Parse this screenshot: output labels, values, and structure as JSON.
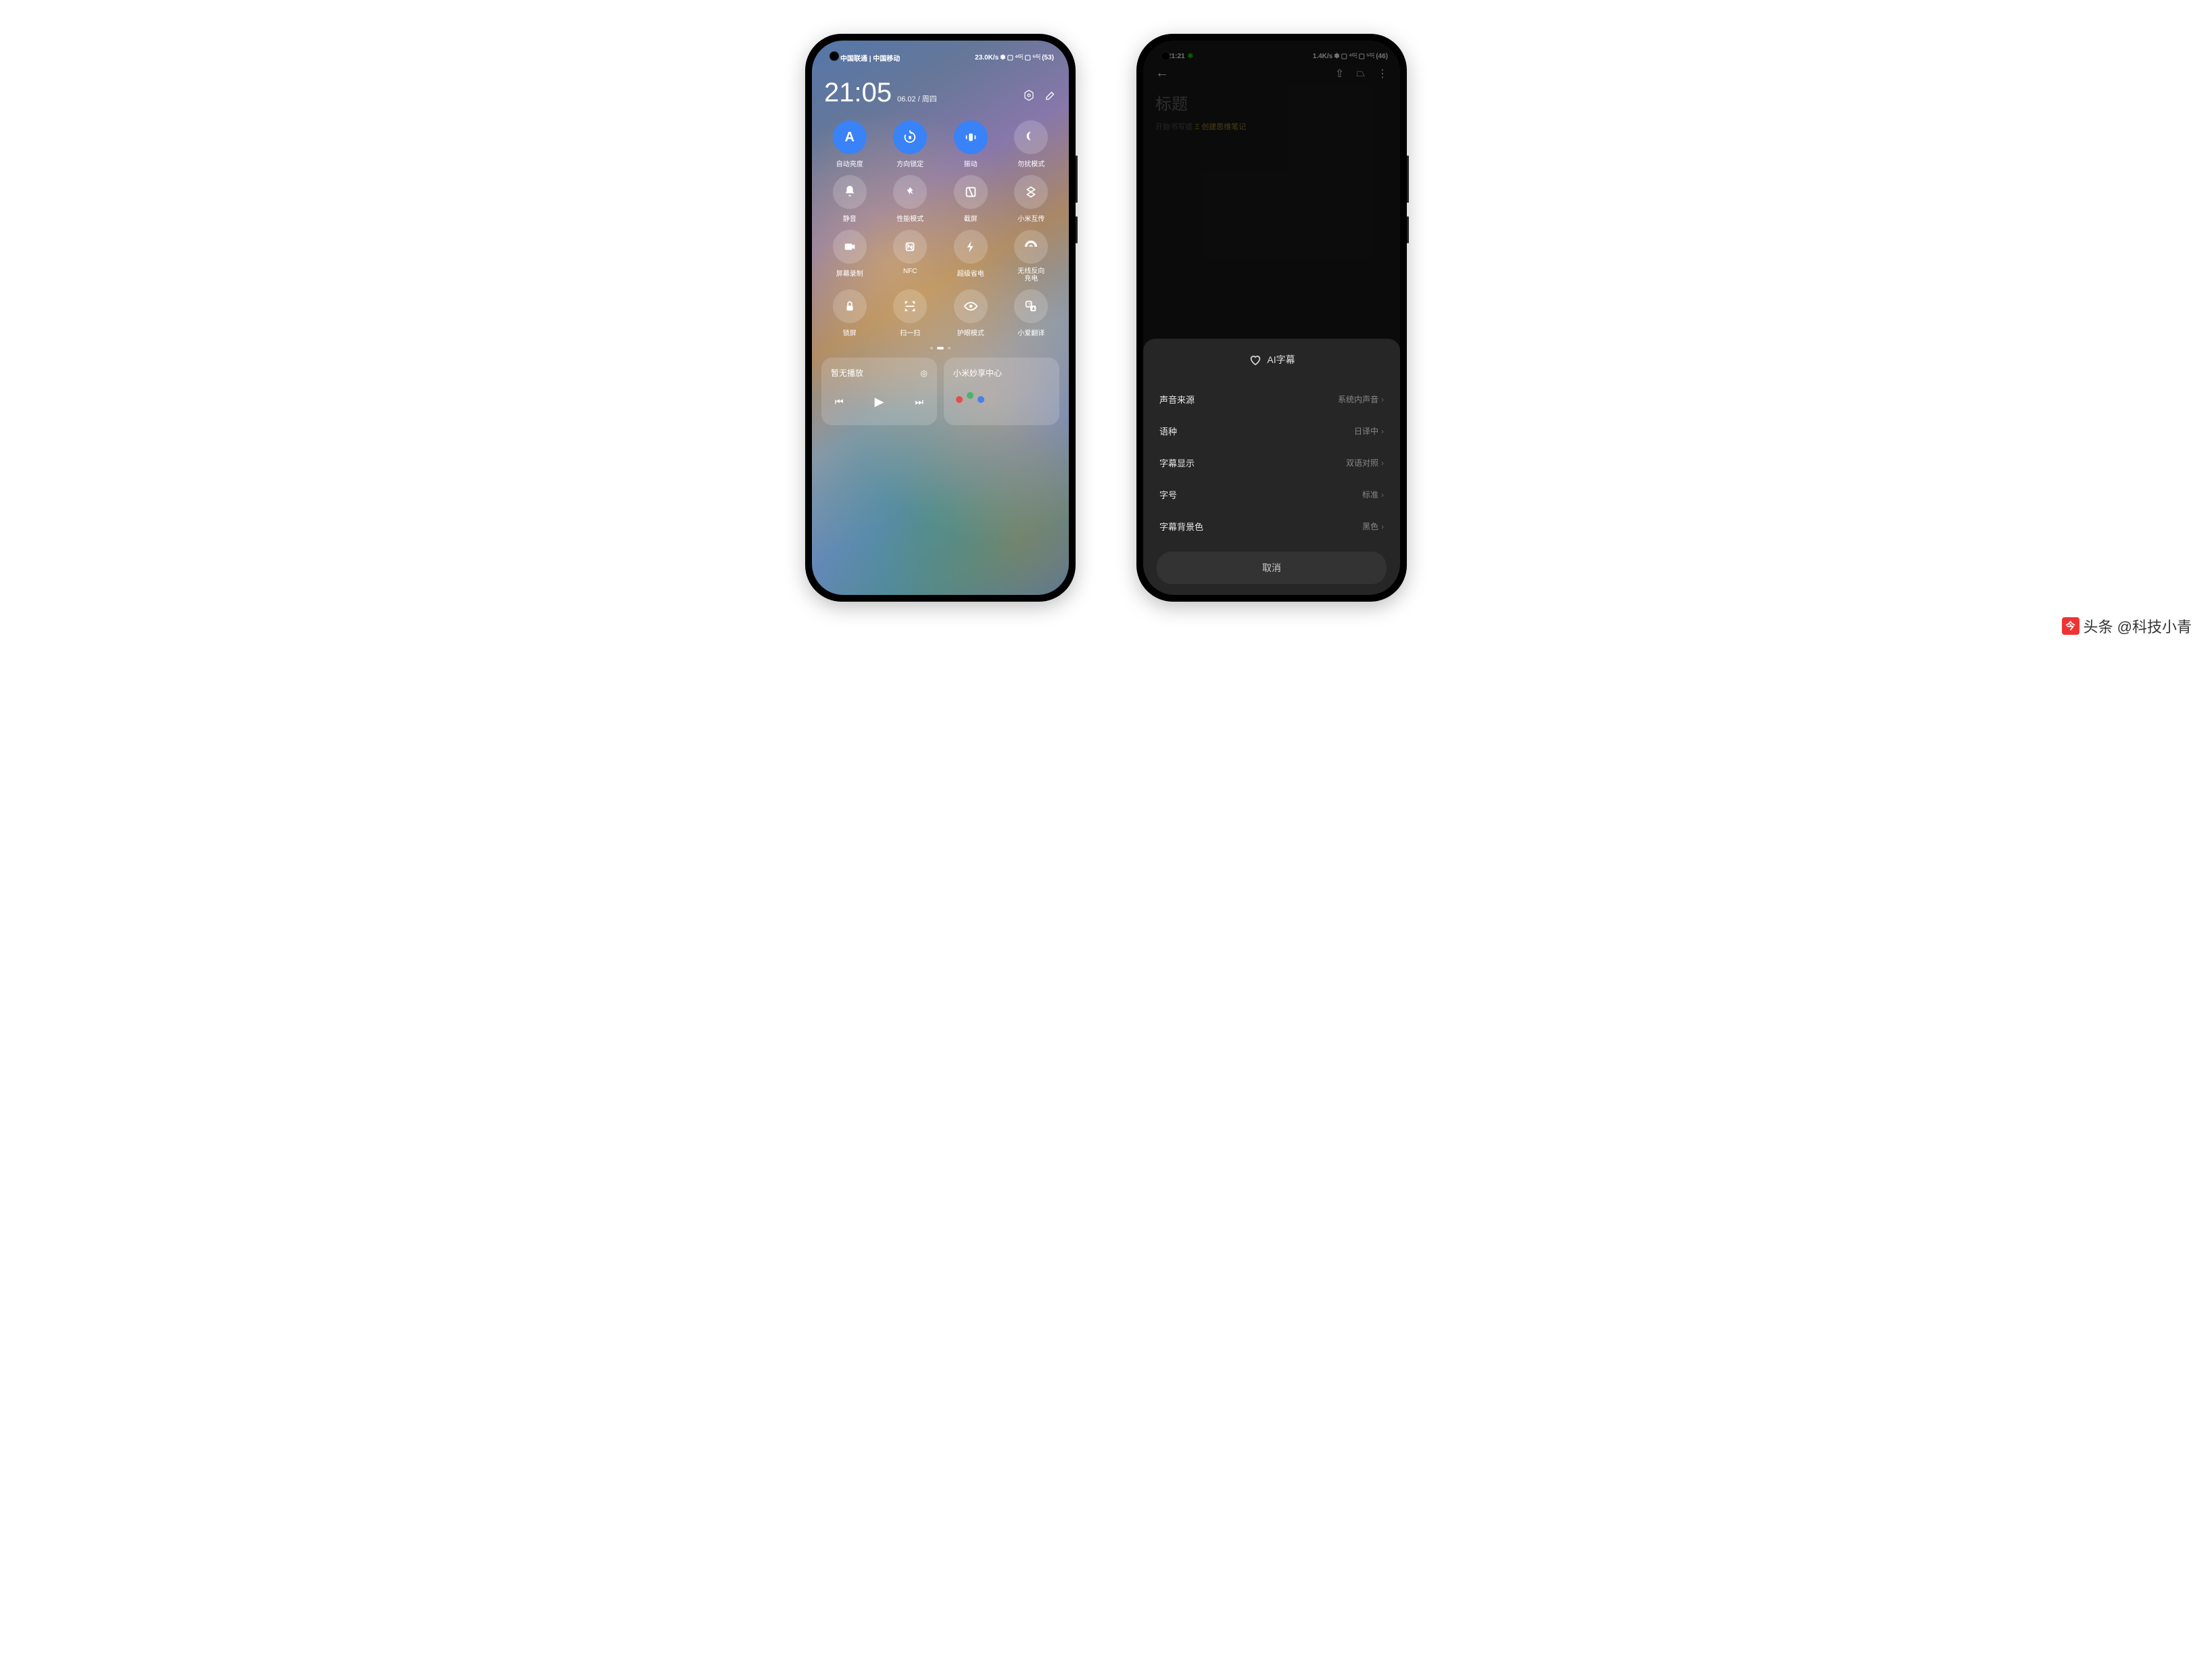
{
  "phone1": {
    "status": {
      "carrier": "中国联通 | 中国移动",
      "speed": "23.0K/s",
      "battery": "53"
    },
    "time": "21:05",
    "date": "06.02 / 周四",
    "tiles": [
      {
        "label": "自动亮度",
        "on": true,
        "icon": "A"
      },
      {
        "label": "方向锁定",
        "on": true,
        "icon": "rotate"
      },
      {
        "label": "振动",
        "on": true,
        "icon": "vibrate"
      },
      {
        "label": "勿扰模式",
        "on": false,
        "icon": "moon"
      },
      {
        "label": "静音",
        "on": false,
        "icon": "bell"
      },
      {
        "label": "性能模式",
        "on": false,
        "icon": "boost"
      },
      {
        "label": "截屏",
        "on": false,
        "icon": "screenshot"
      },
      {
        "label": "小米互传",
        "on": false,
        "icon": "transfer"
      },
      {
        "label": "屏幕录制",
        "on": false,
        "icon": "record"
      },
      {
        "label": "NFC",
        "on": false,
        "icon": "nfc"
      },
      {
        "label": "超级省电",
        "on": false,
        "icon": "bolt"
      },
      {
        "label": "无线反向充电",
        "on": false,
        "icon": "wireless",
        "sub": true
      },
      {
        "label": "锁屏",
        "on": false,
        "icon": "lock"
      },
      {
        "label": "扫一扫",
        "on": false,
        "icon": "scan"
      },
      {
        "label": "护眼模式",
        "on": false,
        "icon": "eye"
      },
      {
        "label": "小爱翻译",
        "on": false,
        "icon": "translate"
      }
    ],
    "media": {
      "title": "暂无播放"
    },
    "share": {
      "title": "小米妙享中心"
    }
  },
  "phone2": {
    "status": {
      "time": "21:21",
      "speed": "1.4K/s",
      "battery": "46"
    },
    "note": {
      "title": "标题",
      "placeholder": "开始书写或",
      "ai": "Ξ 创建思维笔记"
    },
    "sheet": {
      "title": "AI字幕",
      "rows": [
        {
          "label": "声音来源",
          "value": "系统内声音"
        },
        {
          "label": "语种",
          "value": "日译中"
        },
        {
          "label": "字幕显示",
          "value": "双语对照"
        },
        {
          "label": "字号",
          "value": "标准"
        },
        {
          "label": "字幕背景色",
          "value": "黑色"
        }
      ],
      "cancel": "取消"
    }
  },
  "watermark": "头条 @科技小青"
}
